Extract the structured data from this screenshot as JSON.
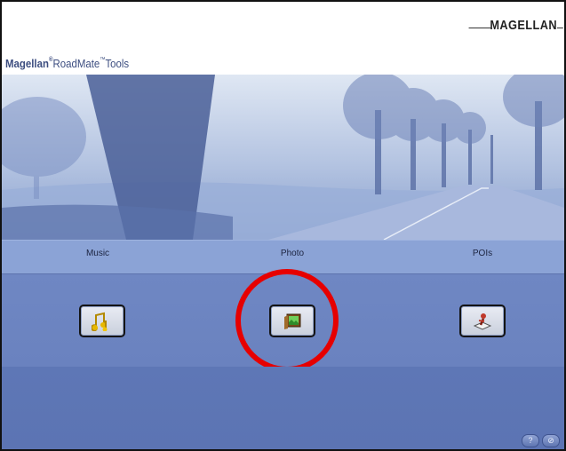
{
  "brand": {
    "logo_text": "MAGELLAN"
  },
  "app": {
    "title_bold": "Magellan",
    "title_rest": "RoadMate",
    "title_tail": "Tools"
  },
  "tools": [
    {
      "label": "Music",
      "icon": "music-notes-icon"
    },
    {
      "label": "Photo",
      "icon": "photo-frame-icon"
    },
    {
      "label": "POIs",
      "icon": "poi-pushpin-icon"
    }
  ],
  "highlight": {
    "target": "Photo",
    "color": "#e60000"
  },
  "footer": {
    "buttons": [
      {
        "icon": "help-icon",
        "glyph": "?"
      },
      {
        "icon": "close-icon",
        "glyph": "⊘"
      }
    ]
  },
  "colors": {
    "band": "#8ba3d6",
    "panel": "#6f87c3",
    "title": "#3d4e80"
  }
}
